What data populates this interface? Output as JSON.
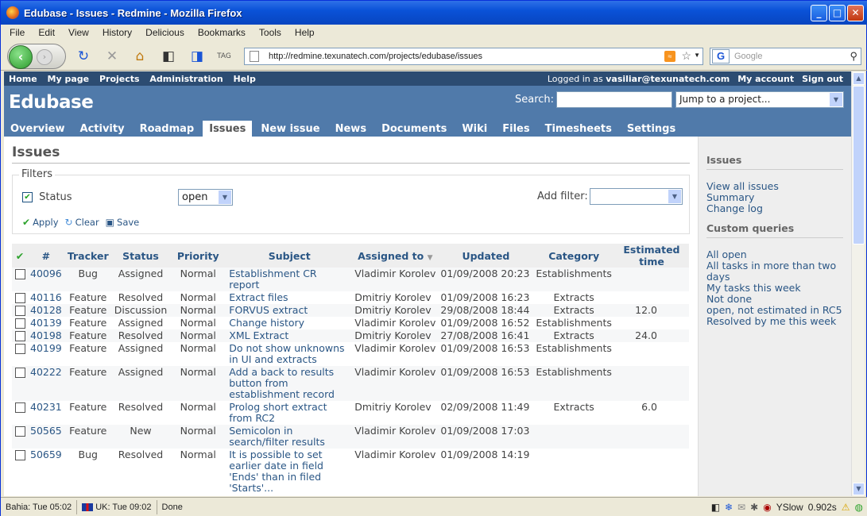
{
  "window": {
    "title": "Edubase - Issues - Redmine - Mozilla Firefox"
  },
  "menubar": [
    "File",
    "Edit",
    "View",
    "History",
    "Delicious",
    "Bookmarks",
    "Tools",
    "Help"
  ],
  "nav": {
    "url": "http://redmine.texunatech.com/projects/edubase/issues",
    "search_placeholder": "Google"
  },
  "topmenu": {
    "links": [
      "Home",
      "My page",
      "Projects",
      "Administration",
      "Help"
    ],
    "logged_prefix": "Logged in as",
    "user": "vasiliar@texunatech.com",
    "my_account": "My account",
    "sign_out": "Sign out"
  },
  "header": {
    "project": "Edubase",
    "search_label": "Search:",
    "jump": "Jump to a project..."
  },
  "tabs": [
    "Overview",
    "Activity",
    "Roadmap",
    "Issues",
    "New issue",
    "News",
    "Documents",
    "Wiki",
    "Files",
    "Timesheets",
    "Settings"
  ],
  "main": {
    "title": "Issues",
    "filters_legend": "Filters",
    "status_label": "Status",
    "status_value": "open",
    "add_filter": "Add filter:",
    "apply": "Apply",
    "clear": "Clear",
    "save": "Save"
  },
  "table": {
    "headers": [
      "#",
      "Tracker",
      "Status",
      "Priority",
      "Subject",
      "Assigned to",
      "Updated",
      "Category",
      "Estimated time"
    ],
    "rows": [
      [
        "40096",
        "Bug",
        "Assigned",
        "Normal",
        "Establishment CR report",
        "Vladimir Korolev",
        "01/09/2008 20:23",
        "Establishments",
        ""
      ],
      [
        "40116",
        "Feature",
        "Resolved",
        "Normal",
        "Extract files",
        "Dmitriy Korolev",
        "01/09/2008 16:23",
        "Extracts",
        ""
      ],
      [
        "40128",
        "Feature",
        "Discussion",
        "Normal",
        "FORVUS extract",
        "Dmitriy Korolev",
        "29/08/2008 18:44",
        "Extracts",
        "12.0"
      ],
      [
        "40139",
        "Feature",
        "Assigned",
        "Normal",
        "Change history",
        "Vladimir Korolev",
        "01/09/2008 16:52",
        "Establishments",
        ""
      ],
      [
        "40198",
        "Feature",
        "Resolved",
        "Normal",
        "XML Extract",
        "Dmitriy Korolev",
        "27/08/2008 16:41",
        "Extracts",
        "24.0"
      ],
      [
        "40199",
        "Feature",
        "Assigned",
        "Normal",
        "Do not show unknowns in UI and extracts",
        "Vladimir Korolev",
        "01/09/2008 16:53",
        "Establishments",
        ""
      ],
      [
        "40222",
        "Feature",
        "Assigned",
        "Normal",
        "Add a back to results button from establishment record",
        "Vladimir Korolev",
        "01/09/2008 16:53",
        "Establishments",
        ""
      ],
      [
        "40231",
        "Feature",
        "Resolved",
        "Normal",
        "Prolog short extract from RC2",
        "Dmitriy Korolev",
        "02/09/2008 11:49",
        "Extracts",
        "6.0"
      ],
      [
        "50565",
        "Feature",
        "New",
        "Normal",
        "Semicolon in search/filter results",
        "Vladimir Korolev",
        "01/09/2008 17:03",
        "",
        ""
      ],
      [
        "50659",
        "Bug",
        "Resolved",
        "Normal",
        "It is possible to set earlier date in field 'Ends' than in filed 'Starts'...",
        "Vladimir Korolev",
        "01/09/2008 14:19",
        "",
        ""
      ]
    ]
  },
  "sidebar": {
    "issues_title": "Issues",
    "issues_links": [
      "View all issues",
      "Summary",
      "Change log"
    ],
    "cq_title": "Custom queries",
    "cq_links": [
      "All open",
      "All tasks in more than two days",
      "My tasks this week",
      "Not done",
      "open, not estimated in RC5",
      "Resolved by me this week"
    ]
  },
  "statusbar": {
    "clock1": "Bahia: Tue 05:02",
    "clock2": "UK: Tue 09:02",
    "status": "Done",
    "yslow": "YSlow",
    "time": "0.902s"
  }
}
